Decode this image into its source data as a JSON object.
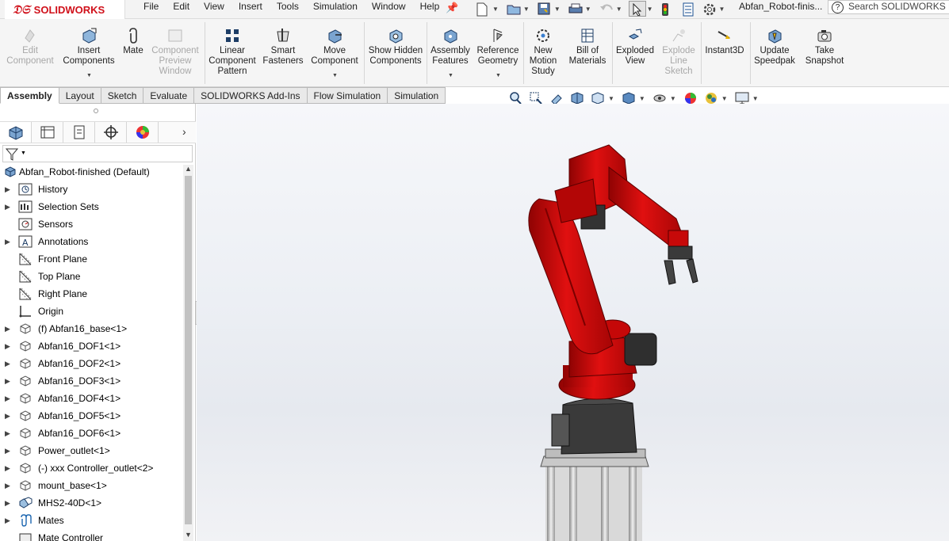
{
  "app": {
    "logo_text": "SOLIDWORKS",
    "doc_title": "Abfan_Robot-finis...",
    "search_placeholder": "Search SOLIDWORKS Help"
  },
  "menu": [
    "File",
    "Edit",
    "View",
    "Insert",
    "Tools",
    "Simulation",
    "Window",
    "Help"
  ],
  "commands": [
    {
      "label": "Edit Component",
      "icon": "edit-component-icon",
      "enabled": false
    },
    {
      "label": "Insert Components",
      "icon": "insert-components-icon",
      "enabled": true
    },
    {
      "label": "Mate",
      "icon": "mate-icon",
      "enabled": true
    },
    {
      "label": "Component Preview Window",
      "icon": "component-preview-icon",
      "enabled": false
    },
    {
      "label": "Linear Component Pattern",
      "icon": "linear-pattern-icon",
      "enabled": true
    },
    {
      "label": "Smart Fasteners",
      "icon": "smart-fasteners-icon",
      "enabled": true
    },
    {
      "label": "Move Component",
      "icon": "move-component-icon",
      "enabled": true
    },
    {
      "label": "Show Hidden Components",
      "icon": "show-hidden-icon",
      "enabled": true
    },
    {
      "label": "Assembly Features",
      "icon": "assembly-features-icon",
      "enabled": true
    },
    {
      "label": "Reference Geometry",
      "icon": "reference-geometry-icon",
      "enabled": true
    },
    {
      "label": "New Motion Study",
      "icon": "motion-study-icon",
      "enabled": true
    },
    {
      "label": "Bill of Materials",
      "icon": "bom-icon",
      "enabled": true
    },
    {
      "label": "Exploded View",
      "icon": "exploded-view-icon",
      "enabled": true
    },
    {
      "label": "Explode Line Sketch",
      "icon": "explode-line-icon",
      "enabled": false
    },
    {
      "label": "Instant3D",
      "icon": "instant3d-icon",
      "enabled": true
    },
    {
      "label": "Update Speedpak",
      "icon": "speedpak-icon",
      "enabled": true
    },
    {
      "label": "Take Snapshot",
      "icon": "snapshot-icon",
      "enabled": true
    }
  ],
  "tabs": [
    {
      "label": "Assembly",
      "active": true
    },
    {
      "label": "Layout",
      "active": false
    },
    {
      "label": "Sketch",
      "active": false
    },
    {
      "label": "Evaluate",
      "active": false
    },
    {
      "label": "SOLIDWORKS Add-Ins",
      "active": false
    },
    {
      "label": "Flow Simulation",
      "active": false
    },
    {
      "label": "Simulation",
      "active": false
    }
  ],
  "tree": {
    "root": "Abfan_Robot-finished  (Default)",
    "items": [
      {
        "label": "History",
        "icon": "history-icon",
        "expandable": true
      },
      {
        "label": "Selection Sets",
        "icon": "selection-sets-icon",
        "expandable": true
      },
      {
        "label": "Sensors",
        "icon": "sensors-icon",
        "expandable": false
      },
      {
        "label": "Annotations",
        "icon": "annotations-icon",
        "expandable": true
      },
      {
        "label": "Front Plane",
        "icon": "plane-icon",
        "expandable": false
      },
      {
        "label": "Top Plane",
        "icon": "plane-icon",
        "expandable": false
      },
      {
        "label": "Right Plane",
        "icon": "plane-icon",
        "expandable": false
      },
      {
        "label": "Origin",
        "icon": "origin-icon",
        "expandable": false
      },
      {
        "label": "(f) Abfan16_base<1>",
        "icon": "part-icon",
        "expandable": true
      },
      {
        "label": "Abfan16_DOF1<1>",
        "icon": "part-icon",
        "expandable": true
      },
      {
        "label": "Abfan16_DOF2<1>",
        "icon": "part-icon",
        "expandable": true
      },
      {
        "label": "Abfan16_DOF3<1>",
        "icon": "part-icon",
        "expandable": true
      },
      {
        "label": "Abfan16_DOF4<1>",
        "icon": "part-icon",
        "expandable": true
      },
      {
        "label": "Abfan16_DOF5<1>",
        "icon": "part-icon",
        "expandable": true
      },
      {
        "label": "Abfan16_DOF6<1>",
        "icon": "part-icon",
        "expandable": true
      },
      {
        "label": "Power_outlet<1>",
        "icon": "part-icon",
        "expandable": true
      },
      {
        "label": "(-) xxx Controller_outlet<2>",
        "icon": "part-icon",
        "expandable": true
      },
      {
        "label": "mount_base<1>",
        "icon": "part-icon",
        "expandable": true
      },
      {
        "label": "MHS2-40D<1>",
        "icon": "subassembly-icon",
        "expandable": true
      },
      {
        "label": "Mates",
        "icon": "mates-icon",
        "expandable": true
      },
      {
        "label": "Mate Controller",
        "icon": "mate-controller-icon",
        "expandable": false
      }
    ]
  },
  "colors": {
    "robot_red": "#d80a0a",
    "robot_dark_red": "#8f0303",
    "base_dark": "#3a3a3a",
    "accent_blue": "#1a66b0"
  }
}
